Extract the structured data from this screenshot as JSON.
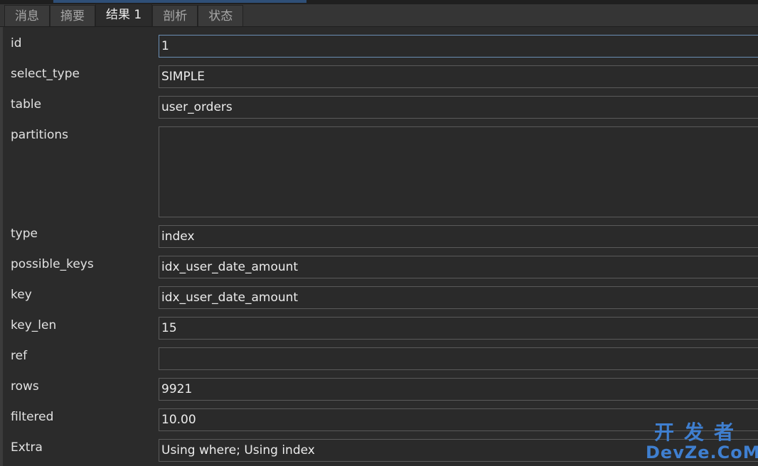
{
  "tabs": [
    {
      "label": "消息"
    },
    {
      "label": "摘要"
    },
    {
      "label": "结果 1"
    },
    {
      "label": "剖析"
    },
    {
      "label": "状态"
    }
  ],
  "active_tab": "结果 1",
  "fields": [
    {
      "label": "id",
      "value": "1"
    },
    {
      "label": "select_type",
      "value": "SIMPLE"
    },
    {
      "label": "table",
      "value": "user_orders"
    },
    {
      "label": "partitions",
      "value": ""
    },
    {
      "label": "type",
      "value": "index"
    },
    {
      "label": "possible_keys",
      "value": "idx_user_date_amount"
    },
    {
      "label": "key",
      "value": "idx_user_date_amount"
    },
    {
      "label": "key_len",
      "value": "15"
    },
    {
      "label": "ref",
      "value": ""
    },
    {
      "label": "rows",
      "value": "9921"
    },
    {
      "label": "filtered",
      "value": "10.00"
    },
    {
      "label": "Extra",
      "value": "Using where; Using index"
    }
  ],
  "watermark": {
    "cn": "开发者",
    "en": "DevZe.CoM"
  },
  "colors": {
    "background": "#2b2b2b",
    "tab_bar": "#353535",
    "field_border": "#5a5a5a",
    "focus_border": "#6b8fb5",
    "watermark": "#3f7fd0"
  }
}
